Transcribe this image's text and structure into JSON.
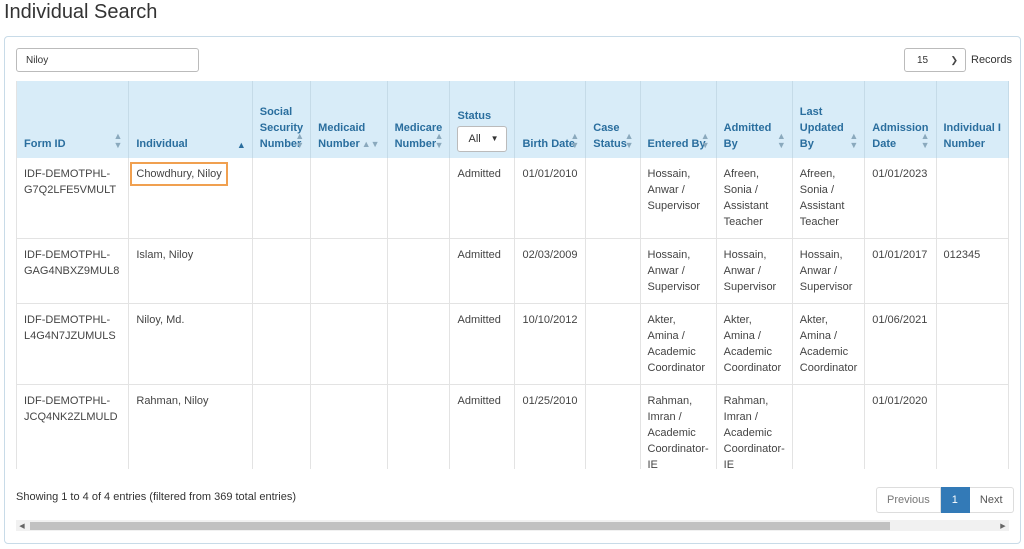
{
  "page": {
    "title": "Individual Search"
  },
  "search": {
    "value": "Niloy"
  },
  "records": {
    "value": "15",
    "label": "Records"
  },
  "table": {
    "headers": {
      "form_id": "Form ID",
      "individual": "Individual",
      "ssn": [
        "Social",
        "Security",
        "Number"
      ],
      "medicaid": [
        "Medicaid",
        "Number"
      ],
      "medicare": [
        "Medicare",
        "Number"
      ],
      "status": "Status",
      "status_filter": "All",
      "birth_date": "Birth Date",
      "case_status": [
        "Case",
        "Status"
      ],
      "entered_by": "Entered By",
      "admitted_by": [
        "Admitted",
        "By"
      ],
      "last_updated_by": [
        "Last",
        "Updated",
        "By"
      ],
      "admission_date": [
        "Admission",
        "Date"
      ],
      "individual_number": [
        "Individual I",
        "Number"
      ]
    },
    "rows": [
      {
        "form_id": [
          "IDF-DEMOTPHL-",
          "G7Q2LFE5VMULT"
        ],
        "individual": "Chowdhury, Niloy",
        "status": "Admitted",
        "birth_date": "01/01/2010",
        "entered_by": [
          "Hossain,",
          "Anwar /",
          "Supervisor"
        ],
        "admitted_by": [
          "Afreen,",
          "Sonia /",
          "Assistant",
          "Teacher"
        ],
        "last_updated_by": [
          "Afreen,",
          "Sonia /",
          "Assistant",
          "Teacher"
        ],
        "admission_date": "01/01/2023",
        "individual_number": ""
      },
      {
        "form_id": [
          "IDF-DEMOTPHL-",
          "GAG4NBXZ9MUL8"
        ],
        "individual": "Islam, Niloy",
        "status": "Admitted",
        "birth_date": "02/03/2009",
        "entered_by": [
          "Hossain,",
          "Anwar /",
          "Supervisor"
        ],
        "admitted_by": [
          "Hossain,",
          "Anwar /",
          "Supervisor"
        ],
        "last_updated_by": [
          "Hossain,",
          "Anwar /",
          "Supervisor"
        ],
        "admission_date": "01/01/2017",
        "individual_number": "012345"
      },
      {
        "form_id": [
          "IDF-DEMOTPHL-",
          "L4G4N7JZUMULS"
        ],
        "individual": "Niloy, Md.",
        "status": "Admitted",
        "birth_date": "10/10/2012",
        "entered_by": [
          "Akter,",
          "Amina /",
          "Academic",
          "Coordinator"
        ],
        "admitted_by": [
          "Akter,",
          "Amina /",
          "Academic",
          "Coordinator"
        ],
        "last_updated_by": [
          "Akter,",
          "Amina /",
          "Academic",
          "Coordinator"
        ],
        "admission_date": "01/06/2021",
        "individual_number": ""
      },
      {
        "form_id": [
          "IDF-DEMOTPHL-",
          "JCQ4NK2ZLMULD"
        ],
        "individual": "Rahman, Niloy",
        "status": "Admitted",
        "birth_date": "01/25/2010",
        "entered_by": [
          "Rahman,",
          "Imran /",
          "Academic",
          "Coordinator-",
          "IE"
        ],
        "admitted_by": [
          "Rahman,",
          "Imran /",
          "Academic",
          "Coordinator-",
          "IE"
        ],
        "last_updated_by": [],
        "admission_date": "01/01/2020",
        "individual_number": ""
      }
    ]
  },
  "footer": {
    "info": "Showing 1 to 4 of 4 entries (filtered from 369 total entries)",
    "previous": "Previous",
    "current_page": "1",
    "next": "Next"
  },
  "icons": {
    "sort": "sort-icon",
    "sort_asc": "sort-asc-icon",
    "chevron": "chevron-down-icon",
    "caret": "caret-down-icon"
  }
}
